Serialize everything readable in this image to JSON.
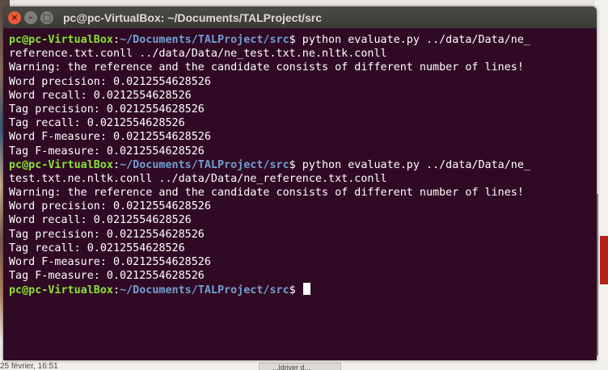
{
  "window": {
    "title": "pc@pc-VirtualBox: ~/Documents/TALProject/src",
    "controls": {
      "close": "×",
      "minimize": "–",
      "maximize": "□"
    }
  },
  "background": {
    "timestamp": "25 février, 16:51",
    "chip": "...ldriver d..."
  },
  "prompt": {
    "user_host": "pc@pc-VirtualBox",
    "separator": ":",
    "path": "~/Documents/TALProject/src",
    "symbol": "$ "
  },
  "session": [
    {
      "type": "prompt",
      "command": "python evaluate.py ../data/Data/ne_"
    },
    {
      "type": "out",
      "text": "reference.txt.conll ../data/Data/ne_test.txt.ne.nltk.conll"
    },
    {
      "type": "out",
      "text": "Warning: the reference and the candidate consists of different number of lines!"
    },
    {
      "type": "out",
      "text": "Word precision: 0.0212554628526"
    },
    {
      "type": "out",
      "text": "Word recall: 0.0212554628526"
    },
    {
      "type": "out",
      "text": "Tag precision: 0.0212554628526"
    },
    {
      "type": "out",
      "text": "Tag recall: 0.0212554628526"
    },
    {
      "type": "out",
      "text": "Word F-measure: 0.0212554628526"
    },
    {
      "type": "out",
      "text": "Tag F-measure: 0.0212554628526"
    },
    {
      "type": "prompt",
      "command": "python evaluate.py ../data/Data/ne_"
    },
    {
      "type": "out",
      "text": "test.txt.ne.nltk.conll ../data/Data/ne_reference.txt.conll"
    },
    {
      "type": "out",
      "text": "Warning: the reference and the candidate consists of different number of lines!"
    },
    {
      "type": "out",
      "text": "Word precision: 0.0212554628526"
    },
    {
      "type": "out",
      "text": "Word recall: 0.0212554628526"
    },
    {
      "type": "out",
      "text": "Tag precision: 0.0212554628526"
    },
    {
      "type": "out",
      "text": "Tag recall: 0.0212554628526"
    },
    {
      "type": "out",
      "text": "Word F-measure: 0.0212554628526"
    },
    {
      "type": "out",
      "text": "Tag F-measure: 0.0212554628526"
    },
    {
      "type": "prompt",
      "command": "",
      "cursor": true
    }
  ],
  "colors": {
    "terminal_bg": "#300a24",
    "prompt_user": "#8ae234",
    "prompt_path": "#729fcf",
    "text": "#ffffff",
    "close_button": "#ef5a37"
  }
}
